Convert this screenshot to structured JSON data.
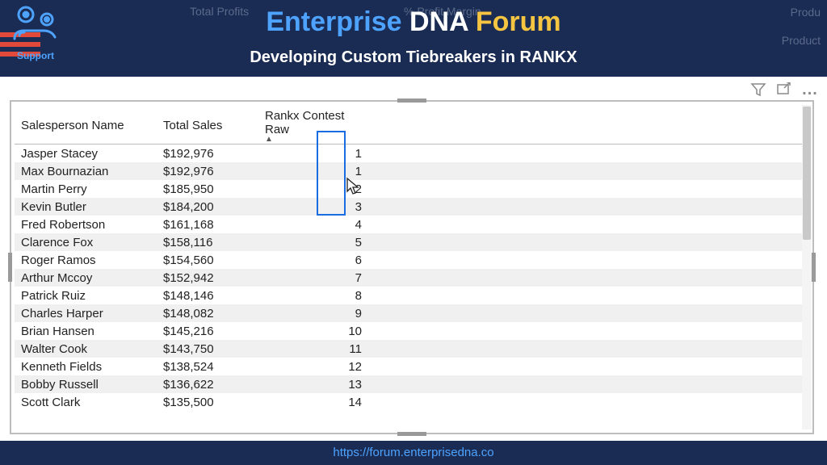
{
  "header": {
    "bg_labels": {
      "total_profits": "Total Profits",
      "profit_margin": "% Profit Margin",
      "prod1": "Produ",
      "prod2": "Product"
    },
    "title_a": "Enterprise ",
    "title_b": "DNA ",
    "title_c": "Forum",
    "subtitle": "Developing Custom Tiebreakers in RANKX",
    "support": "Support"
  },
  "table": {
    "col1": "Salesperson Name",
    "col2": "Total Sales",
    "col3": "Rankx Contest Raw",
    "rows": [
      {
        "name": "Jasper Stacey",
        "sales": "$192,976",
        "rank": "1"
      },
      {
        "name": "Max Bournazian",
        "sales": "$192,976",
        "rank": "1"
      },
      {
        "name": "Martin Perry",
        "sales": "$185,950",
        "rank": "2"
      },
      {
        "name": "Kevin Butler",
        "sales": "$184,200",
        "rank": "3"
      },
      {
        "name": "Fred Robertson",
        "sales": "$161,168",
        "rank": "4"
      },
      {
        "name": "Clarence Fox",
        "sales": "$158,116",
        "rank": "5"
      },
      {
        "name": "Roger Ramos",
        "sales": "$154,560",
        "rank": "6"
      },
      {
        "name": "Arthur Mccoy",
        "sales": "$152,942",
        "rank": "7"
      },
      {
        "name": "Patrick Ruiz",
        "sales": "$148,146",
        "rank": "8"
      },
      {
        "name": "Charles Harper",
        "sales": "$148,082",
        "rank": "9"
      },
      {
        "name": "Brian Hansen",
        "sales": "$145,216",
        "rank": "10"
      },
      {
        "name": "Walter Cook",
        "sales": "$143,750",
        "rank": "11"
      },
      {
        "name": "Kenneth Fields",
        "sales": "$138,524",
        "rank": "12"
      },
      {
        "name": "Bobby Russell",
        "sales": "$136,622",
        "rank": "13"
      },
      {
        "name": "Scott Clark",
        "sales": "$135,500",
        "rank": "14"
      }
    ]
  },
  "footer": {
    "url": "https://forum.enterprisedna.co"
  },
  "toolbar": {
    "more": "..."
  }
}
